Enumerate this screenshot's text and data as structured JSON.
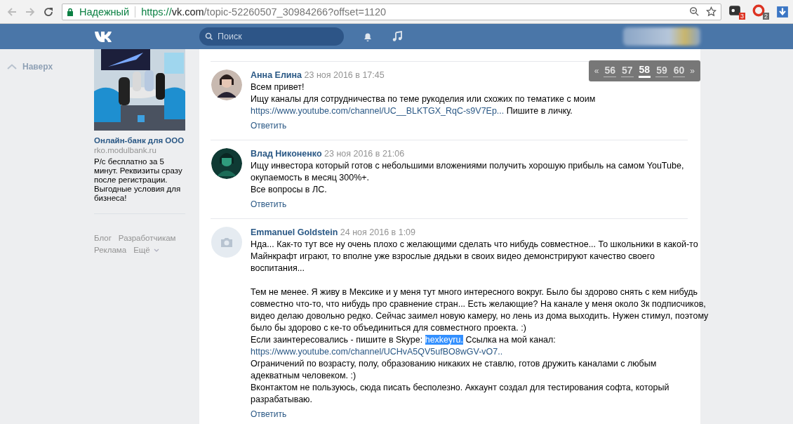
{
  "browser": {
    "secure_label": "Надежный",
    "url": {
      "scheme": "https://",
      "host": "vk.com",
      "path": "/topic-52260507_30984266?offset=1120"
    },
    "extension_badges": [
      "3",
      "2"
    ]
  },
  "header": {
    "search": {
      "placeholder": "Поиск"
    }
  },
  "back_to_top": "Наверх",
  "ad": {
    "title": "Онлайн-банк для ООО",
    "domain": "rko.modulbank.ru",
    "text": "Р/с бесплатно за 5 минут. Реквизиты сразу после регистрации. Выгодные условия для бизнеса!"
  },
  "footer_links": [
    {
      "label": "Блог"
    },
    {
      "label": "Разработчикам"
    },
    {
      "label": "Реклама"
    },
    {
      "label": "Ещё",
      "dropdown": true
    }
  ],
  "pagination": {
    "prev": "«",
    "next": "»",
    "pages": [
      {
        "label": "56",
        "selected": false
      },
      {
        "label": "57",
        "selected": false
      },
      {
        "label": "58",
        "selected": true
      },
      {
        "label": "59",
        "selected": false
      },
      {
        "label": "60",
        "selected": false
      }
    ]
  },
  "posts": [
    {
      "author": "Анна Елина",
      "date": "23 ноя 2016 в 17:45",
      "avatar": {
        "kind": "picture"
      },
      "reply": "Ответить",
      "paragraphs": [
        [
          [
            {
              "text": "Всем привет!",
              "kind": "plain"
            }
          ],
          [
            {
              "text": "Ищу каналы для сотрудничества по теме рукоделия или схожих по тематике с моим",
              "kind": "plain"
            }
          ],
          [
            {
              "text": "https://www.youtube.com/channel/UC__BLKTGX_RqC-s9V7Ep...",
              "kind": "link"
            },
            {
              "text": " Пишите в личку.",
              "kind": "plain"
            }
          ]
        ]
      ]
    },
    {
      "author": "Влад Никоненко",
      "date": "23 ноя 2016 в 21:06",
      "avatar": {
        "kind": "picture"
      },
      "reply": "Ответить",
      "paragraphs": [
        [
          [
            {
              "text": "Ищу инвестора который готов с небольшими вложениями получить хорошую прибыль на самом YouTube,",
              "kind": "plain"
            }
          ],
          [
            {
              "text": "окупаемость в месяц 300%+.",
              "kind": "plain"
            }
          ],
          [
            {
              "text": "Все вопросы в ЛС.",
              "kind": "plain"
            }
          ]
        ]
      ]
    },
    {
      "author": "Emmanuel Goldstein",
      "date": "24 ноя 2016 в 1:09",
      "avatar": {
        "kind": "placeholder"
      },
      "reply": "Ответить",
      "paragraphs": [
        [
          [
            {
              "text": "Нда... Как-то тут все ну очень плохо с желающими сделать что нибудь совместное... То школьники в какой-то",
              "kind": "plain"
            }
          ],
          [
            {
              "text": "Майнкрафт играют, то вполне уже взрослые дядьки в своих видео демонстрируют качество своего",
              "kind": "plain"
            }
          ],
          [
            {
              "text": "воспитания...",
              "kind": "plain"
            }
          ]
        ],
        [
          [
            {
              "text": "Тем не менее. Я живу в Мексике и у меня тут много интересного вокруг. Было бы здорово снять с кем нибудь",
              "kind": "plain"
            }
          ],
          [
            {
              "text": "совместно что-то, что нибудь про сравнение стран... Есть желающие? На канале у меня около 3к подписчиков,",
              "kind": "plain"
            }
          ],
          [
            {
              "text": "видео делаю довольно редко. Сейчас заимел новую камеру, но лень из дома выходить. Нужен стимул, поэтому",
              "kind": "plain"
            }
          ],
          [
            {
              "text": "было бы здорово с ке-то объединиться для совместного проекта. :)",
              "kind": "plain"
            }
          ],
          [
            {
              "text": "Если заинтересовались - пишите в Skype: ",
              "kind": "plain"
            },
            {
              "text": "hexkeyru.",
              "kind": "selected"
            },
            {
              "text": " Ссылка на мой канал:",
              "kind": "plain"
            }
          ],
          [
            {
              "text": "https://www.youtube.com/channel/UCHvA5QV5ufBO8wGV-vO7..",
              "kind": "link"
            }
          ],
          [
            {
              "text": "Ограничений по возрасту, полу, образованию никаких не ставлю, готов дружить каналами с любым",
              "kind": "plain"
            }
          ],
          [
            {
              "text": "адекватным человеком. :)",
              "kind": "plain"
            }
          ],
          [
            {
              "text": "Вконтактом не пользуюсь, сюда писать бесполезно. Аккаунт создал для тестирования софта, который",
              "kind": "plain"
            }
          ],
          [
            {
              "text": "разрабатываю.",
              "kind": "plain"
            }
          ]
        ]
      ]
    }
  ]
}
